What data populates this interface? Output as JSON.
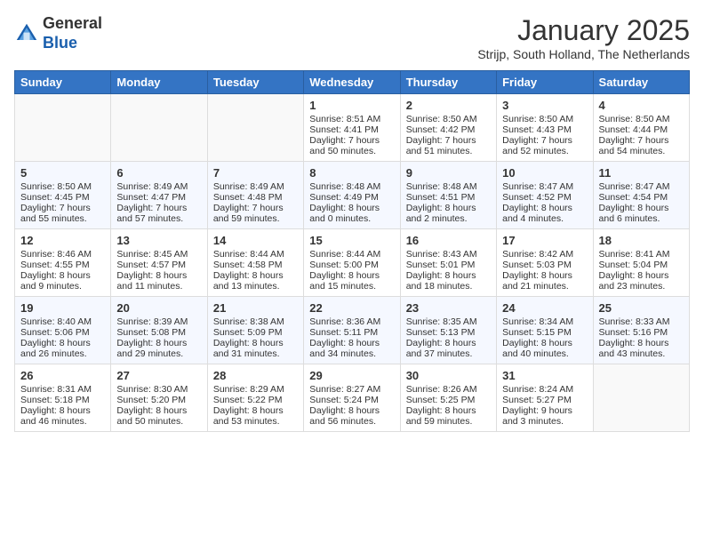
{
  "header": {
    "logo_line1": "General",
    "logo_line2": "Blue",
    "month_title": "January 2025",
    "subtitle": "Strijp, South Holland, The Netherlands"
  },
  "weekdays": [
    "Sunday",
    "Monday",
    "Tuesday",
    "Wednesday",
    "Thursday",
    "Friday",
    "Saturday"
  ],
  "weeks": [
    [
      {
        "day": "",
        "sunrise": "",
        "sunset": "",
        "daylight": ""
      },
      {
        "day": "",
        "sunrise": "",
        "sunset": "",
        "daylight": ""
      },
      {
        "day": "",
        "sunrise": "",
        "sunset": "",
        "daylight": ""
      },
      {
        "day": "1",
        "sunrise": "Sunrise: 8:51 AM",
        "sunset": "Sunset: 4:41 PM",
        "daylight": "Daylight: 7 hours and 50 minutes."
      },
      {
        "day": "2",
        "sunrise": "Sunrise: 8:50 AM",
        "sunset": "Sunset: 4:42 PM",
        "daylight": "Daylight: 7 hours and 51 minutes."
      },
      {
        "day": "3",
        "sunrise": "Sunrise: 8:50 AM",
        "sunset": "Sunset: 4:43 PM",
        "daylight": "Daylight: 7 hours and 52 minutes."
      },
      {
        "day": "4",
        "sunrise": "Sunrise: 8:50 AM",
        "sunset": "Sunset: 4:44 PM",
        "daylight": "Daylight: 7 hours and 54 minutes."
      }
    ],
    [
      {
        "day": "5",
        "sunrise": "Sunrise: 8:50 AM",
        "sunset": "Sunset: 4:45 PM",
        "daylight": "Daylight: 7 hours and 55 minutes."
      },
      {
        "day": "6",
        "sunrise": "Sunrise: 8:49 AM",
        "sunset": "Sunset: 4:47 PM",
        "daylight": "Daylight: 7 hours and 57 minutes."
      },
      {
        "day": "7",
        "sunrise": "Sunrise: 8:49 AM",
        "sunset": "Sunset: 4:48 PM",
        "daylight": "Daylight: 7 hours and 59 minutes."
      },
      {
        "day": "8",
        "sunrise": "Sunrise: 8:48 AM",
        "sunset": "Sunset: 4:49 PM",
        "daylight": "Daylight: 8 hours and 0 minutes."
      },
      {
        "day": "9",
        "sunrise": "Sunrise: 8:48 AM",
        "sunset": "Sunset: 4:51 PM",
        "daylight": "Daylight: 8 hours and 2 minutes."
      },
      {
        "day": "10",
        "sunrise": "Sunrise: 8:47 AM",
        "sunset": "Sunset: 4:52 PM",
        "daylight": "Daylight: 8 hours and 4 minutes."
      },
      {
        "day": "11",
        "sunrise": "Sunrise: 8:47 AM",
        "sunset": "Sunset: 4:54 PM",
        "daylight": "Daylight: 8 hours and 6 minutes."
      }
    ],
    [
      {
        "day": "12",
        "sunrise": "Sunrise: 8:46 AM",
        "sunset": "Sunset: 4:55 PM",
        "daylight": "Daylight: 8 hours and 9 minutes."
      },
      {
        "day": "13",
        "sunrise": "Sunrise: 8:45 AM",
        "sunset": "Sunset: 4:57 PM",
        "daylight": "Daylight: 8 hours and 11 minutes."
      },
      {
        "day": "14",
        "sunrise": "Sunrise: 8:44 AM",
        "sunset": "Sunset: 4:58 PM",
        "daylight": "Daylight: 8 hours and 13 minutes."
      },
      {
        "day": "15",
        "sunrise": "Sunrise: 8:44 AM",
        "sunset": "Sunset: 5:00 PM",
        "daylight": "Daylight: 8 hours and 15 minutes."
      },
      {
        "day": "16",
        "sunrise": "Sunrise: 8:43 AM",
        "sunset": "Sunset: 5:01 PM",
        "daylight": "Daylight: 8 hours and 18 minutes."
      },
      {
        "day": "17",
        "sunrise": "Sunrise: 8:42 AM",
        "sunset": "Sunset: 5:03 PM",
        "daylight": "Daylight: 8 hours and 21 minutes."
      },
      {
        "day": "18",
        "sunrise": "Sunrise: 8:41 AM",
        "sunset": "Sunset: 5:04 PM",
        "daylight": "Daylight: 8 hours and 23 minutes."
      }
    ],
    [
      {
        "day": "19",
        "sunrise": "Sunrise: 8:40 AM",
        "sunset": "Sunset: 5:06 PM",
        "daylight": "Daylight: 8 hours and 26 minutes."
      },
      {
        "day": "20",
        "sunrise": "Sunrise: 8:39 AM",
        "sunset": "Sunset: 5:08 PM",
        "daylight": "Daylight: 8 hours and 29 minutes."
      },
      {
        "day": "21",
        "sunrise": "Sunrise: 8:38 AM",
        "sunset": "Sunset: 5:09 PM",
        "daylight": "Daylight: 8 hours and 31 minutes."
      },
      {
        "day": "22",
        "sunrise": "Sunrise: 8:36 AM",
        "sunset": "Sunset: 5:11 PM",
        "daylight": "Daylight: 8 hours and 34 minutes."
      },
      {
        "day": "23",
        "sunrise": "Sunrise: 8:35 AM",
        "sunset": "Sunset: 5:13 PM",
        "daylight": "Daylight: 8 hours and 37 minutes."
      },
      {
        "day": "24",
        "sunrise": "Sunrise: 8:34 AM",
        "sunset": "Sunset: 5:15 PM",
        "daylight": "Daylight: 8 hours and 40 minutes."
      },
      {
        "day": "25",
        "sunrise": "Sunrise: 8:33 AM",
        "sunset": "Sunset: 5:16 PM",
        "daylight": "Daylight: 8 hours and 43 minutes."
      }
    ],
    [
      {
        "day": "26",
        "sunrise": "Sunrise: 8:31 AM",
        "sunset": "Sunset: 5:18 PM",
        "daylight": "Daylight: 8 hours and 46 minutes."
      },
      {
        "day": "27",
        "sunrise": "Sunrise: 8:30 AM",
        "sunset": "Sunset: 5:20 PM",
        "daylight": "Daylight: 8 hours and 50 minutes."
      },
      {
        "day": "28",
        "sunrise": "Sunrise: 8:29 AM",
        "sunset": "Sunset: 5:22 PM",
        "daylight": "Daylight: 8 hours and 53 minutes."
      },
      {
        "day": "29",
        "sunrise": "Sunrise: 8:27 AM",
        "sunset": "Sunset: 5:24 PM",
        "daylight": "Daylight: 8 hours and 56 minutes."
      },
      {
        "day": "30",
        "sunrise": "Sunrise: 8:26 AM",
        "sunset": "Sunset: 5:25 PM",
        "daylight": "Daylight: 8 hours and 59 minutes."
      },
      {
        "day": "31",
        "sunrise": "Sunrise: 8:24 AM",
        "sunset": "Sunset: 5:27 PM",
        "daylight": "Daylight: 9 hours and 3 minutes."
      },
      {
        "day": "",
        "sunrise": "",
        "sunset": "",
        "daylight": ""
      }
    ]
  ]
}
